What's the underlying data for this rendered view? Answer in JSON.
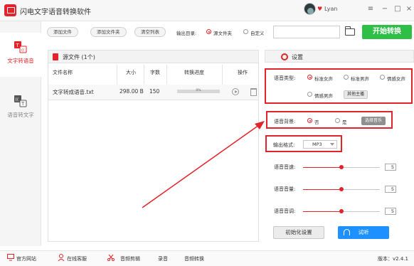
{
  "app": {
    "title": "闪电文字语音转换软件",
    "user_name": "Lyan",
    "window_controls": [
      "≡",
      "−",
      "□",
      "×"
    ]
  },
  "sidebar": {
    "items": [
      {
        "label": "文字转语音",
        "icon": "text-to-speech-icon",
        "active": true
      },
      {
        "label": "语音转文字",
        "icon": "speech-to-text-icon",
        "active": false
      }
    ]
  },
  "toolbar": {
    "add_file": "添加文件",
    "add_folder": "添加文件夹",
    "clear_list": "清空列表",
    "output_label": "输出目录:",
    "output_options": [
      "源文件夹",
      "自定义"
    ],
    "output_selected": "源文件夹",
    "path_value": "",
    "start_button": "开始转换"
  },
  "file_panel": {
    "title": "源文件 (1个)",
    "columns": [
      "文件名称",
      "大小",
      "字数",
      "转换进度",
      "操作"
    ],
    "rows": [
      {
        "name": "文字转成语音.txt",
        "size": "298.00 B",
        "words": "150",
        "progress": "0%",
        "progress_value": 0
      }
    ]
  },
  "settings": {
    "title": "设置",
    "voice_type_label": "语音类型:",
    "voice_types": [
      "标准女声",
      "标准男声",
      "情感女声",
      "情感男声"
    ],
    "voice_selected": "标准女声",
    "special_voice_button": "其他主播",
    "bg_music_label": "语音背景:",
    "bg_music_options": [
      "否",
      "是"
    ],
    "bg_music_selected": "否",
    "choose_music_button": "选择音乐",
    "format_label": "输出格式:",
    "format_value": "MP3",
    "speed_label": "语音音速:",
    "speed_value": "5",
    "volume_label": "语音音量:",
    "volume_value": "5",
    "pitch_label": "语音音调:",
    "pitch_value": "5",
    "slider_fraction": 0.5,
    "init_button": "初始化设置",
    "listen_button": "试听"
  },
  "statusbar": {
    "items": [
      "官方网站",
      "在线客服",
      "音频剪辑",
      "录音",
      "音频转换"
    ],
    "version": "版本：v2.4.1"
  },
  "colors": {
    "accent": "#e2232a",
    "start_green": "#2fbf47",
    "listen_blue": "#1e90ff"
  }
}
